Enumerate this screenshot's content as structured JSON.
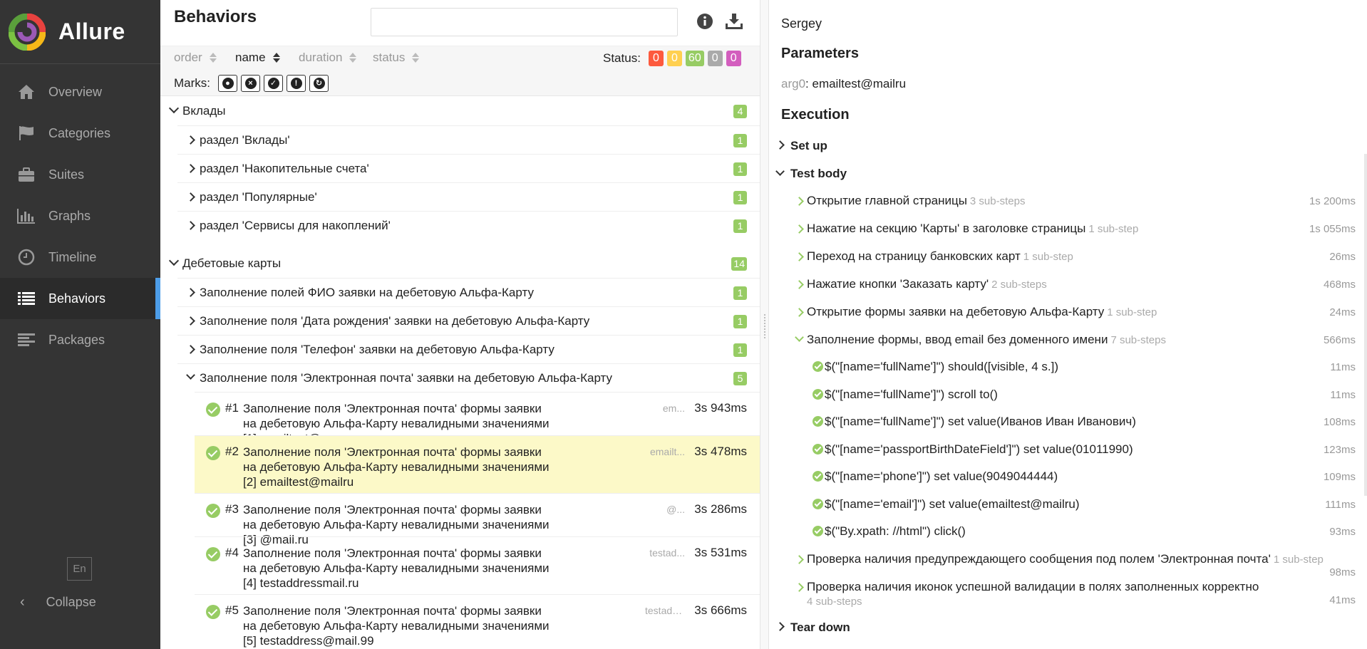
{
  "app": {
    "name": "Allure",
    "colors": {
      "passed": "#97cc64",
      "failed": "#fd5a3e",
      "broken": "#ffd050",
      "skipped": "#aaaaaa",
      "unknown": "#d35ebe",
      "accent": "#4d9de8"
    }
  },
  "sidebar": {
    "items": [
      {
        "label": "Overview",
        "icon": "home-icon"
      },
      {
        "label": "Categories",
        "icon": "flag-icon"
      },
      {
        "label": "Suites",
        "icon": "briefcase-icon"
      },
      {
        "label": "Graphs",
        "icon": "bar-chart-icon"
      },
      {
        "label": "Timeline",
        "icon": "clock-icon"
      },
      {
        "label": "Behaviors",
        "icon": "list-icon",
        "active": true
      },
      {
        "label": "Packages",
        "icon": "align-left-icon"
      }
    ],
    "language": "En",
    "collapse_label": "Collapse"
  },
  "behaviors": {
    "title": "Behaviors",
    "search": {
      "value": "",
      "placeholder": ""
    },
    "sort": {
      "order": "order",
      "name": "name",
      "duration": "duration",
      "status": "status"
    },
    "status": {
      "label": "Status:",
      "failed": "0",
      "broken": "0",
      "passed": "60",
      "skipped": "0",
      "unknown": "0"
    },
    "marks_label": "Marks:",
    "groups": [
      {
        "name": "Вклады",
        "count": "4",
        "children": [
          {
            "name": "раздел 'Вклады'",
            "count": "1"
          },
          {
            "name": "раздел 'Накопительные счета'",
            "count": "1"
          },
          {
            "name": "раздел 'Популярные'",
            "count": "1"
          },
          {
            "name": "раздел 'Сервисы для накоплений'",
            "count": "1"
          }
        ]
      },
      {
        "name": "Дебетовые карты",
        "count": "14",
        "children": [
          {
            "name": "Заполнение полей ФИО заявки на дебетовую Альфа-Карту",
            "count": "1"
          },
          {
            "name": "Заполнение поля 'Дата рождения' заявки на дебетовую Альфа-Карту",
            "count": "1"
          },
          {
            "name": "Заполнение поля 'Телефон' заявки на дебетовую Альфа-Карту",
            "count": "1"
          },
          {
            "name": "Заполнение поля 'Электронная почта' заявки на дебетовую Альфа-Карту",
            "count": "5"
          }
        ]
      }
    ],
    "tests": [
      {
        "num": "#1",
        "name": "Заполнение поля 'Электронная почта' формы заявки на дебетовую Альфа-Карту невалидными значениями [1] emailtest@",
        "param": "em...",
        "duration": "3s 943ms"
      },
      {
        "num": "#2",
        "name": "Заполнение поля 'Электронная почта' формы заявки на дебетовую Альфа-Карту невалидными значениями [2] emailtest@mailru",
        "param": "emailt...",
        "duration": "3s 478ms",
        "selected": true
      },
      {
        "num": "#3",
        "name": "Заполнение поля 'Электронная почта' формы заявки на дебетовую Альфа-Карту невалидными значениями [3] @mail.ru",
        "param": "@...",
        "duration": "3s 286ms"
      },
      {
        "num": "#4",
        "name": "Заполнение поля 'Электронная почта' формы заявки на дебетовую Альфа-Карту невалидными значениями [4] testaddressmail.ru",
        "param": "testad...",
        "duration": "3s 531ms"
      },
      {
        "num": "#5",
        "name": "Заполнение поля 'Электронная почта' формы заявки на дебетовую Альфа-Карту невалидными значениями [5] testaddress@mail.99",
        "param": "testadd...",
        "duration": "3s 666ms"
      }
    ]
  },
  "detail": {
    "owner": "Sergey",
    "parameters_title": "Parameters",
    "param_key": "arg0",
    "param_value": "emailtest@mailru",
    "execution_title": "Execution",
    "setup_label": "Set up",
    "body_label": "Test body",
    "teardown_label": "Tear down",
    "steps": [
      {
        "name": "Открытие главной страницы",
        "sub": "3 sub-steps",
        "duration": "1s 200ms"
      },
      {
        "name": "Нажатие на секцию 'Карты' в заголовке страницы",
        "sub": "1 sub-step",
        "duration": "1s 055ms"
      },
      {
        "name": "Переход на страницу банковских карт",
        "sub": "1 sub-step",
        "duration": "26ms"
      },
      {
        "name": "Нажатие кнопки 'Заказать карту'",
        "sub": "2 sub-steps",
        "duration": "468ms"
      },
      {
        "name": "Открытие формы заявки на дебетовую Альфа-Карту",
        "sub": "1 sub-step",
        "duration": "24ms"
      },
      {
        "name": "Заполнение формы, ввод email без доменного имени",
        "sub": "7 sub-steps",
        "duration": "566ms",
        "expanded": true
      }
    ],
    "substeps": [
      {
        "name": "$(\"[name='fullName']\") should([visible, 4 s.])",
        "duration": "11ms"
      },
      {
        "name": "$(\"[name='fullName']\") scroll to()",
        "duration": "11ms"
      },
      {
        "name": "$(\"[name='fullName']\") set value(Иванов Иван Иванович)",
        "duration": "108ms"
      },
      {
        "name": "$(\"[name='passportBirthDateField']\") set value(01011990)",
        "duration": "123ms"
      },
      {
        "name": "$(\"[name='phone']\") set value(9049044444)",
        "duration": "109ms"
      },
      {
        "name": "$(\"[name='email']\") set value(emailtest@mailru)",
        "duration": "111ms"
      },
      {
        "name": "$(\"By.xpath: //html\") click()",
        "duration": "93ms"
      }
    ],
    "after_steps": [
      {
        "name": "Проверка наличия предупреждающего сообщения под полем 'Электронная почта'",
        "sub": "1 sub-step",
        "duration": "98ms"
      },
      {
        "name": "Проверка наличия иконок успешной валидации в полях заполненных корректно",
        "sub": "4 sub-steps",
        "duration": "41ms"
      }
    ]
  }
}
